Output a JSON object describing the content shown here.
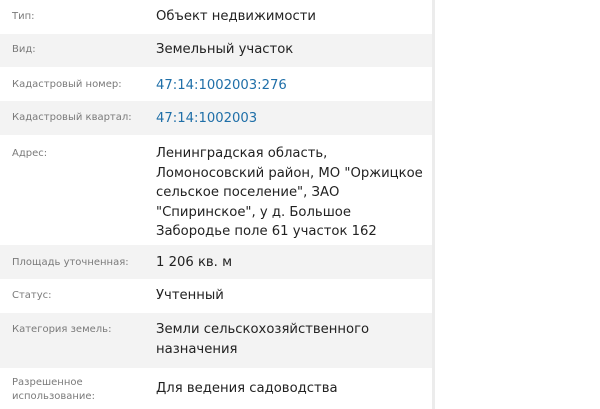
{
  "rows": [
    {
      "label": "Тип:",
      "value": "Объект недвижимости"
    },
    {
      "label": "Вид:",
      "value": "Земельный участок"
    },
    {
      "label": "Кадастровый номер:",
      "value": "47:14:1002003:276"
    },
    {
      "label": "Кадастровый квартал:",
      "value": "47:14:1002003"
    },
    {
      "label": "Адрес:",
      "value": "Ленинградская область, Ломоносовский район, МО \"Оржицкое сельское поселение\", ЗАО \"Спиринское\", у д. Большое Забородье поле 61 участок 162"
    },
    {
      "label": "Площадь уточненная:",
      "value": "1 206 кв. м"
    },
    {
      "label": "Статус:",
      "value": "Учтенный"
    },
    {
      "label": "Категория земель:",
      "value": "Земли сельскохозяйственного назначения"
    },
    {
      "label": "Разрешенное использование:",
      "value": "Для ведения садоводства"
    }
  ]
}
